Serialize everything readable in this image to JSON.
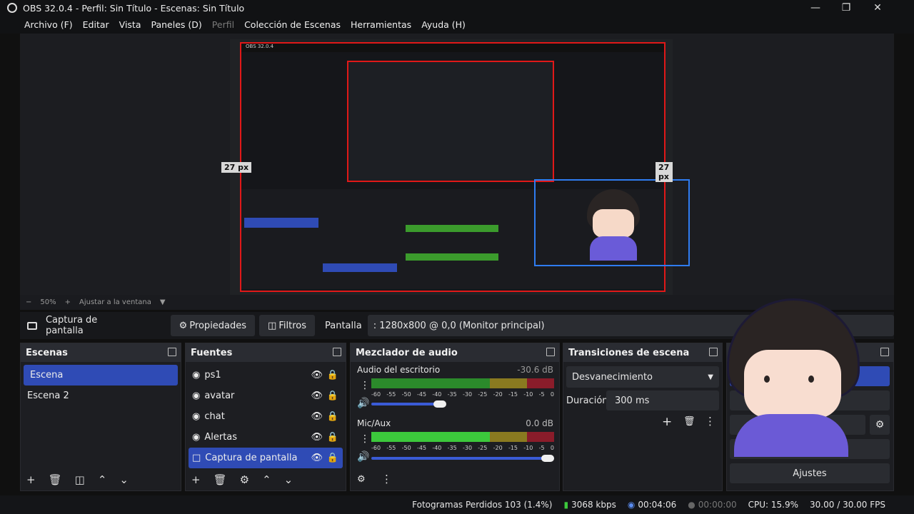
{
  "window": {
    "title": "OBS 32.0.4 - Perfil: Sin Título - Escenas: Sin Título"
  },
  "menu": [
    "Archivo (F)",
    "Editar",
    "Vista",
    "Paneles (D)",
    "Perfil",
    "Colección de Escenas",
    "Herramientas",
    "Ayuda (H)"
  ],
  "preview": {
    "left_px_label": "27 px",
    "right_px_label": "27 px",
    "zoom": "50%",
    "fit": "Ajustar a la ventana"
  },
  "source_bar": {
    "source": "Captura de pantalla",
    "properties": "Propiedades",
    "filters": "Filtros",
    "display_label": "Pantalla",
    "display_value": ": 1280x800 @ 0,0 (Monitor principal)"
  },
  "scenes": {
    "title": "Escenas",
    "items": [
      "Escena",
      "Escena 2"
    ]
  },
  "sources": {
    "title": "Fuentes",
    "items": [
      "ps1",
      "avatar",
      "chat",
      "Alertas",
      "Captura de pantalla"
    ]
  },
  "mixer": {
    "title": "Mezclador de audio",
    "channels": [
      {
        "name": "Audio del escritorio",
        "db": "-30.6 dB"
      },
      {
        "name": "Mic/Aux",
        "db": "0.0 dB"
      }
    ],
    "ticks": [
      "-60",
      "-55",
      "-50",
      "-45",
      "-40",
      "-35",
      "-30",
      "-25",
      "-20",
      "-15",
      "-10",
      "-5",
      "0"
    ]
  },
  "transitions": {
    "title": "Transiciones de escena",
    "type": "Desvanecimiento",
    "duration_label": "Duración",
    "duration": "300 ms"
  },
  "controls": {
    "settings": "Ajustes"
  },
  "status": {
    "dropped": "Fotogramas Perdidos 103 (1.4%)",
    "bitrate": "3068 kbps",
    "stream_time": "00:04:06",
    "rec_time": "00:00:00",
    "cpu": "CPU: 15.9%",
    "fps": "30.00 / 30.00 FPS"
  },
  "colors": {
    "accent": "#2f4bb5",
    "bounding_red": "#e01818",
    "selection_blue": "#2f7cf0"
  }
}
